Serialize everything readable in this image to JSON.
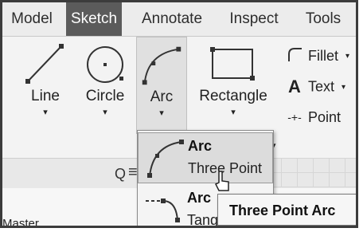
{
  "tabs": [
    {
      "label": "Model"
    },
    {
      "label": "Sketch",
      "active": true
    },
    {
      "label": "Annotate"
    },
    {
      "label": "Inspect"
    },
    {
      "label": "Tools"
    }
  ],
  "ribbon": {
    "tools": [
      {
        "label": "Line",
        "icon": "line-icon"
      },
      {
        "label": "Circle",
        "icon": "circle-icon"
      },
      {
        "label": "Arc",
        "icon": "arc-three-point-icon"
      },
      {
        "label": "Rectangle",
        "icon": "rectangle-icon"
      }
    ],
    "dropdown_glyph": "▾",
    "small_tools": [
      {
        "label": "Fillet",
        "icon": "fillet-icon",
        "has_dropdown": true
      },
      {
        "label": "Text",
        "icon": "text-icon",
        "glyph": "A",
        "has_dropdown": true
      },
      {
        "label": "Point",
        "icon": "point-icon",
        "glyph": "-+-"
      }
    ]
  },
  "arc_dropdown": {
    "items": [
      {
        "title": "Arc",
        "subtitle": "Three Point",
        "icon": "arc-three-point-icon"
      },
      {
        "title": "Arc",
        "subtitle": "Tang",
        "icon": "arc-tangent-icon"
      }
    ]
  },
  "tooltip": {
    "text": "Three Point Arc"
  },
  "browser": {
    "search_glyph": "Q",
    "menu_glyph": "≡",
    "master_label": "Master"
  },
  "colors": {
    "active_tab": "#5b5b5b",
    "ribbon_bg": "#f3f3f3",
    "highlight": "#dcdcdc"
  }
}
